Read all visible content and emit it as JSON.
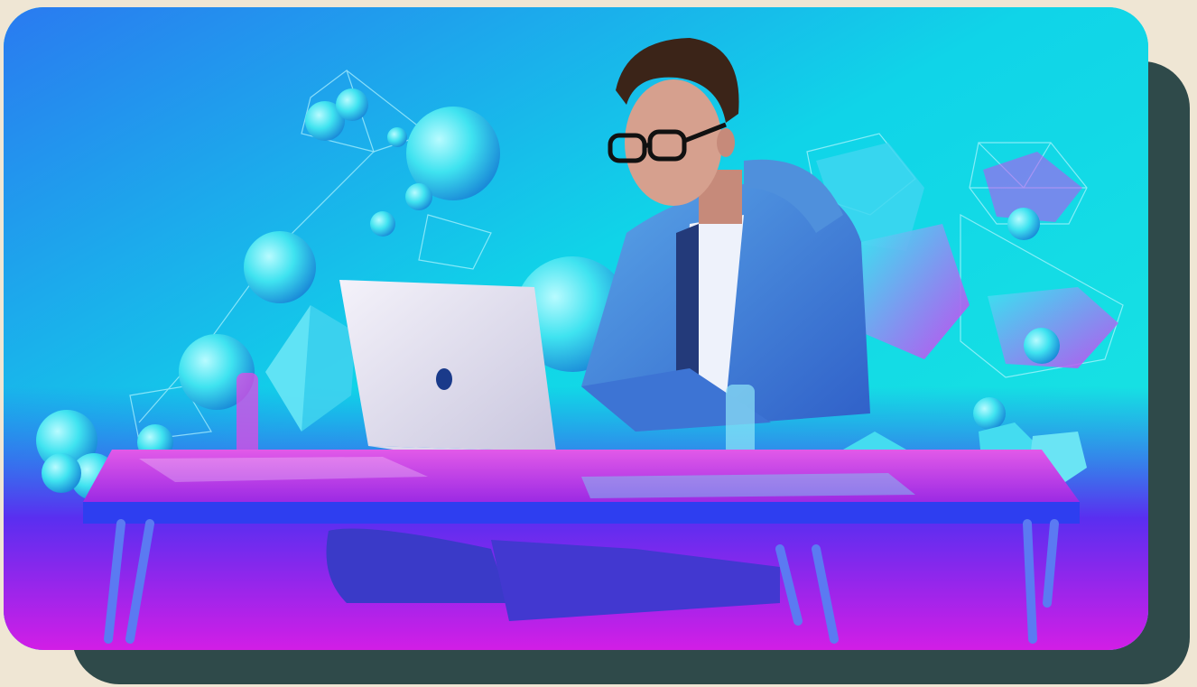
{
  "image": {
    "subject": "man-with-glasses-using-laptop",
    "colors": {
      "page_background": "#efe6d4",
      "shadow_card": "#2f4a4a",
      "sky_top": "#0fe4e0",
      "sky_bottom": "#4a3af2",
      "desk_top": "#d24ce6",
      "accent_magenta": "#e03cf0"
    }
  }
}
